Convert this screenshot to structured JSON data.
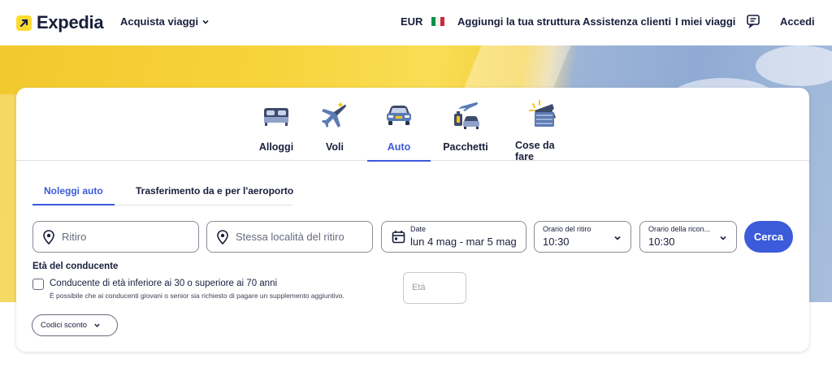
{
  "header": {
    "logo_text": "Expedia",
    "shop_label": "Acquista viaggi",
    "currency": "EUR",
    "nav": [
      "Aggiungi la tua struttura",
      "Assistenza clienti",
      "I miei viaggi"
    ],
    "signin": "Accedi",
    "icons": [
      "expedia-logo-icon",
      "chevron-down-icon",
      "italy-flag-icon",
      "chat-icon"
    ]
  },
  "search": {
    "verticals": [
      {
        "label": "Alloggi",
        "icon": "bed-icon"
      },
      {
        "label": "Voli",
        "icon": "plane-icon"
      },
      {
        "label": "Auto",
        "icon": "car-icon",
        "active": true
      },
      {
        "label": "Pacchetti",
        "icon": "package-icon"
      },
      {
        "label": "Cose da fare",
        "icon": "ticket-icon"
      }
    ],
    "subtabs": [
      {
        "label": "Noleggi auto",
        "active": true
      },
      {
        "label": "Trasferimento da e per l'aeroporto"
      }
    ],
    "pickup_placeholder": "Ritiro",
    "dropoff_placeholder": "Stessa località del ritiro",
    "dates_label": "Date",
    "dates_value": "lun 4 mag - mar 5 mag",
    "pickup_time_label": "Orario del ritiro",
    "pickup_time_value": "10:30",
    "dropoff_time_label": "Orario della ricon...",
    "dropoff_time_value": "10:30",
    "search_button": "Cerca",
    "driver_age_title": "Età del conducente",
    "driver_age_checkbox": "Conducente di età inferiore ai 30 o superiore ai 70 anni",
    "driver_age_note": "È possibile che ai conducenti giovani o senior sia richiesto di pagare un supplemento aggiuntivo.",
    "age_placeholder": "Età",
    "discount_label": "Codici sconto"
  },
  "colors": {
    "brand_yellow": "#fddb32",
    "accent_blue": "#3b5bdb",
    "text_dark": "#191e3b"
  }
}
